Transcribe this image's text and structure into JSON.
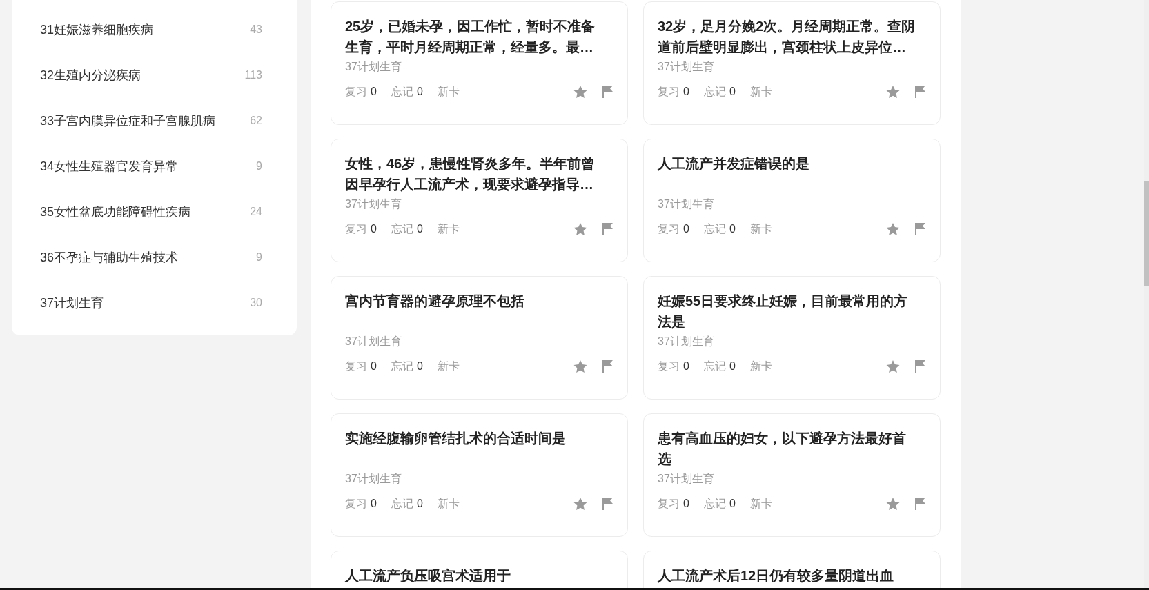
{
  "sidebar": {
    "items": [
      {
        "label": "31妊娠滋养细胞疾病",
        "count": "43",
        "selected": false
      },
      {
        "label": "32生殖内分泌疾病",
        "count": "113",
        "selected": false
      },
      {
        "label": "33子宫内膜异位症和子宫腺肌病",
        "count": "62",
        "selected": false
      },
      {
        "label": "34女性生殖器官发育异常",
        "count": "9",
        "selected": false
      },
      {
        "label": "35女性盆底功能障碍性疾病",
        "count": "24",
        "selected": false
      },
      {
        "label": "36不孕症与辅助生殖技术",
        "count": "9",
        "selected": false
      },
      {
        "label": "37计划生育",
        "count": "30",
        "selected": false
      }
    ]
  },
  "cards": [
    {
      "title": "25岁，已婚未孕，因工作忙，暂时不准备生育，平时月经周期正常，经量多。最…",
      "subject": "37计划生育",
      "stats": [
        {
          "label": "复习",
          "value": "0"
        },
        {
          "label": "忘记",
          "value": "0"
        },
        {
          "label": "新卡"
        }
      ]
    },
    {
      "title": "32岁，足月分娩2次。月经周期正常。查阴道前后壁明显膨出，宫颈柱状上皮异位…",
      "subject": "37计划生育",
      "stats": [
        {
          "label": "复习",
          "value": "0"
        },
        {
          "label": "忘记",
          "value": "0"
        },
        {
          "label": "新卡"
        }
      ]
    },
    {
      "title": "女性，46岁，患慢性肾炎多年。半年前曾因早孕行人工流产术，现要求避孕指导…",
      "subject": "37计划生育",
      "stats": [
        {
          "label": "复习",
          "value": "0"
        },
        {
          "label": "忘记",
          "value": "0"
        },
        {
          "label": "新卡"
        }
      ]
    },
    {
      "title": "人工流产并发症错误的是",
      "subject": "37计划生育",
      "stats": [
        {
          "label": "复习",
          "value": "0"
        },
        {
          "label": "忘记",
          "value": "0"
        },
        {
          "label": "新卡"
        }
      ]
    },
    {
      "title": "宫内节育器的避孕原理不包括",
      "subject": "37计划生育",
      "stats": [
        {
          "label": "复习",
          "value": "0"
        },
        {
          "label": "忘记",
          "value": "0"
        },
        {
          "label": "新卡"
        }
      ]
    },
    {
      "title": "妊娠55日要求终止妊娠，目前最常用的方法是",
      "subject": "37计划生育",
      "stats": [
        {
          "label": "复习",
          "value": "0"
        },
        {
          "label": "忘记",
          "value": "0"
        },
        {
          "label": "新卡"
        }
      ]
    },
    {
      "title": "实施经腹输卵管结扎术的合适时间是",
      "subject": "37计划生育",
      "stats": [
        {
          "label": "复习",
          "value": "0"
        },
        {
          "label": "忘记",
          "value": "0"
        },
        {
          "label": "新卡"
        }
      ]
    },
    {
      "title": "患有高血压的妇女，以下避孕方法最好首选",
      "subject": "37计划生育",
      "stats": [
        {
          "label": "复习",
          "value": "0"
        },
        {
          "label": "忘记",
          "value": "0"
        },
        {
          "label": "新卡"
        }
      ]
    },
    {
      "title": "人工流产负压吸宫术适用于"
    },
    {
      "title": "人工流产术后12日仍有较多量阴道出血"
    }
  ]
}
